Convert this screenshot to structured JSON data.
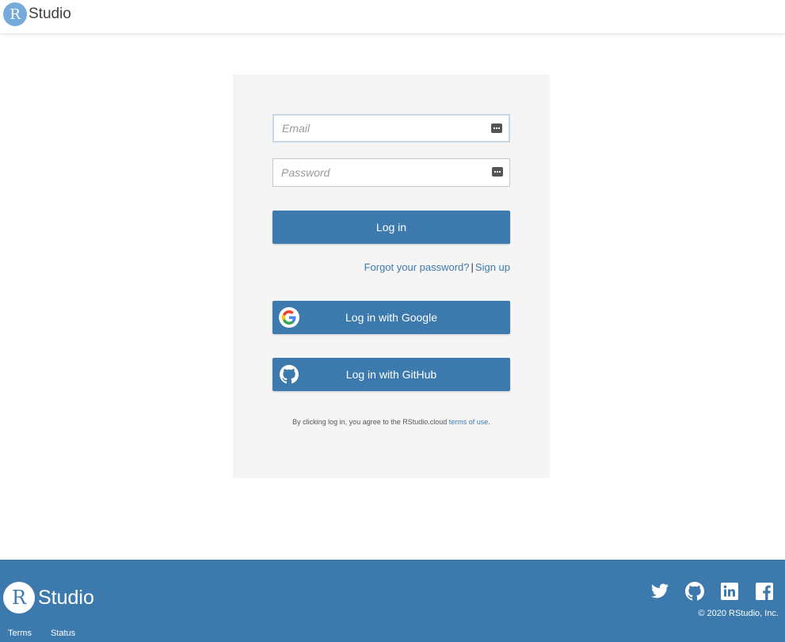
{
  "header": {
    "logo_letter": "R",
    "logo_text": "Studio"
  },
  "login": {
    "email_placeholder": "Email",
    "email_value": "",
    "password_placeholder": "Password",
    "password_value": "",
    "login_label": "Log in",
    "forgot_label": "Forgot your password?",
    "separator": "|",
    "signup_label": "Sign up",
    "google_label": "Log in with Google",
    "github_label": "Log in with GitHub",
    "terms_prefix": "By clicking log in, you agree to the RStudio.cloud",
    "terms_link": "terms of use",
    "terms_suffix": "."
  },
  "footer": {
    "logo_letter": "R",
    "logo_text": "Studio",
    "links": [
      "Terms",
      "Status"
    ],
    "social_icons": [
      "twitter-icon",
      "github-icon",
      "linkedin-icon",
      "facebook-icon"
    ],
    "copyright": "© 2020 RStudio, Inc."
  },
  "colors": {
    "brand_blue": "#3c7aae",
    "logo_blue": "#75aadb",
    "panel_bg": "#f5f5f5"
  }
}
